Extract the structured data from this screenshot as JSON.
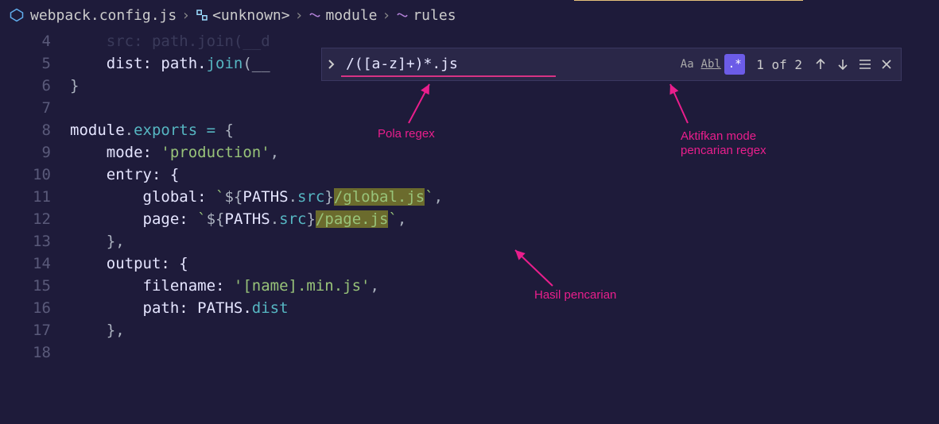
{
  "breadcrumb": {
    "file": "webpack.config.js",
    "symbol1": "<unknown>",
    "symbol2": "module",
    "symbol3": "rules"
  },
  "gutter": [
    "4",
    "5",
    "6",
    "7",
    "8",
    "9",
    "10",
    "11",
    "12",
    "13",
    "14",
    "15",
    "16",
    "17",
    "18"
  ],
  "code": {
    "l4_a": "    src: path.",
    "l4_b": "join",
    "l4_c": "(__d",
    "l5_a": "    dist: path.",
    "l5_b": "join",
    "l5_c": "(__",
    "l6": "}",
    "l8_a": "module",
    "l8_b": ".",
    "l8_c": "exports",
    "l8_d": " ",
    "l8_e": "=",
    "l8_f": " {",
    "l9_a": "    mode: ",
    "l9_b": "'production'",
    "l9_c": ",",
    "l10": "    entry: {",
    "l11_a": "        global: ",
    "l11_b": "`",
    "l11_c": "${",
    "l11_d": "PATHS",
    "l11_e": ".",
    "l11_f": "src",
    "l11_g": "}",
    "l11_h": "/global.js",
    "l11_i": "`",
    "l11_j": ",",
    "l12_a": "        page: ",
    "l12_b": "`",
    "l12_c": "${",
    "l12_d": "PATHS",
    "l12_e": ".",
    "l12_f": "src",
    "l12_g": "}",
    "l12_h": "/page.js",
    "l12_i": "`",
    "l12_j": ",",
    "l13": "    },",
    "l14": "    output: {",
    "l15_a": "        filename: ",
    "l15_b": "'[name].min.js'",
    "l15_c": ",",
    "l16_a": "        path: PATHS.",
    "l16_b": "dist",
    "l17": "    },"
  },
  "find": {
    "value": "/([a-z]+)*.js",
    "count": "1 of 2",
    "opt_case": "Aa",
    "opt_word": "Abl",
    "opt_regex": ".*"
  },
  "annotations": {
    "regex_pattern": "Pola regex",
    "regex_mode_1": "Aktifkan mode",
    "regex_mode_2": "pencarian regex",
    "search_result": "Hasil pencarian"
  }
}
